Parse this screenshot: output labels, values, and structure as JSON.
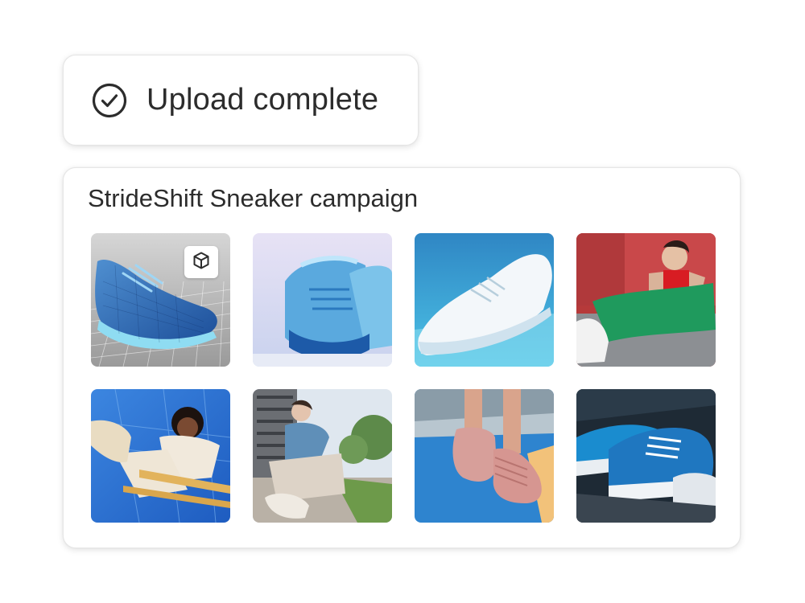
{
  "toast": {
    "icon": "check-circle-icon",
    "message": "Upload complete"
  },
  "campaign": {
    "title": "StrideShift Sneaker campaign",
    "assets": [
      {
        "kind": "3d-model",
        "badge_icon": "cube-icon"
      },
      {
        "kind": "image"
      },
      {
        "kind": "image"
      },
      {
        "kind": "image"
      },
      {
        "kind": "image"
      },
      {
        "kind": "image"
      },
      {
        "kind": "image"
      },
      {
        "kind": "image"
      }
    ]
  },
  "colors": {
    "text": "#2c2c2c",
    "card_border": "#e6e6e6",
    "background": "#ffffff"
  }
}
